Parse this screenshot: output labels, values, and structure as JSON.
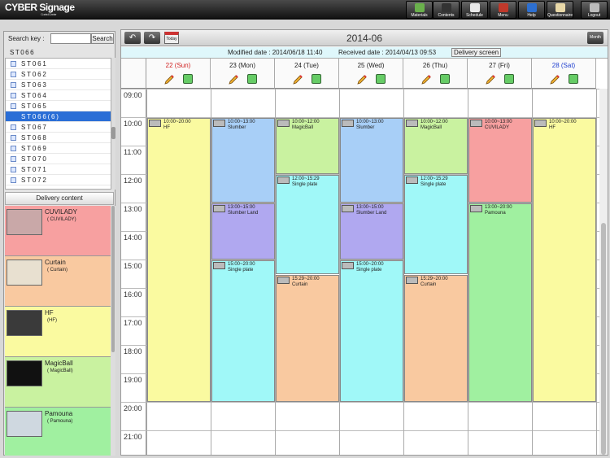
{
  "app": {
    "logo": "CYBER Signage",
    "logo_sub": "Control Center"
  },
  "nav": [
    {
      "label": "Materials",
      "name": "materials-button",
      "icon": "materials-icon",
      "color": "#6ab04c"
    },
    {
      "label": "Contents",
      "name": "contents-button",
      "icon": "contents-icon",
      "color": "#333333"
    },
    {
      "label": "Schedule",
      "name": "schedule-button",
      "icon": "schedule-icon",
      "color": "#e8e8e8"
    },
    {
      "label": "Menu",
      "name": "menu-button",
      "icon": "home-icon",
      "color": "#c0392b"
    },
    {
      "label": "Help",
      "name": "help-button",
      "icon": "help-icon",
      "color": "#2d6fd0"
    },
    {
      "label": "Questionnaire",
      "name": "questionnaire-button",
      "icon": "questionnaire-icon",
      "color": "#e8d8a8"
    },
    {
      "label": "Logout",
      "name": "logout-button",
      "icon": "logout-icon",
      "color": "#bbbbbb"
    }
  ],
  "search": {
    "label": "Search key :",
    "button": "Search",
    "value": ""
  },
  "current_station": "ST066",
  "stations": [
    "ST061",
    "ST062",
    "ST063",
    "ST064",
    "ST065",
    "ST066(6)",
    "ST067",
    "ST068",
    "ST069",
    "ST070",
    "ST071",
    "ST072"
  ],
  "selected_station": "ST066(6)",
  "delivery_content": {
    "header": "Delivery content",
    "items": [
      {
        "name": "CUVILADY",
        "sub": "( CUVILADY)",
        "color": "#f7a0a0"
      },
      {
        "name": "Curtain",
        "sub": "( Curtain)",
        "color": "#f9c9a0"
      },
      {
        "name": "HF",
        "sub": "(HF)",
        "color": "#fafaa0"
      },
      {
        "name": "MagicBall",
        "sub": "( MagicBall)",
        "color": "#c9f2a0"
      },
      {
        "name": "Pamouna",
        "sub": "( Pamouna)",
        "color": "#a0f0a0"
      }
    ]
  },
  "calendar": {
    "month": "2014-06",
    "today_label": "Today",
    "month_button": "Month",
    "modified": "Modified date : 2014/06/18 11:40",
    "received": "Received date : 2014/04/13 09:53",
    "delivery_screen": "Delivery screen",
    "days": [
      {
        "label": "22 (Sun)",
        "color": "#d02020"
      },
      {
        "label": "23 (Mon)",
        "color": "#222222"
      },
      {
        "label": "24 (Tue)",
        "color": "#222222"
      },
      {
        "label": "25 (Wed)",
        "color": "#222222"
      },
      {
        "label": "26 (Thu)",
        "color": "#222222"
      },
      {
        "label": "27 (Fri)",
        "color": "#222222"
      },
      {
        "label": "28 (Sat)",
        "color": "#2040d0"
      }
    ],
    "hours": [
      "09:00",
      "10:00",
      "11:00",
      "12:00",
      "13:00",
      "14:00",
      "15:00",
      "16:00",
      "17:00",
      "18:00",
      "19:00",
      "20:00",
      "21:00"
    ],
    "events": [
      {
        "day": 0,
        "start": 10,
        "end": 20,
        "time": "10:00~20:00",
        "name": "HF",
        "color": "#fafaa0"
      },
      {
        "day": 1,
        "start": 10,
        "end": 13,
        "time": "10:00~13:00",
        "name": "Slumber",
        "color": "#a8cff7"
      },
      {
        "day": 1,
        "start": 13,
        "end": 15,
        "time": "13:00~15:00",
        "name": "Slumber Land",
        "color": "#b0a8f0"
      },
      {
        "day": 1,
        "start": 15,
        "end": 20,
        "time": "15:00~20:00",
        "name": "Single plate",
        "color": "#a0f8f8"
      },
      {
        "day": 2,
        "start": 10,
        "end": 12,
        "time": "10:00~12:00",
        "name": "MagicBall",
        "color": "#c9f2a0"
      },
      {
        "day": 2,
        "start": 12,
        "end": 15.5,
        "time": "12:00~15:29",
        "name": "Single plate",
        "color": "#a0f8f8"
      },
      {
        "day": 2,
        "start": 15.5,
        "end": 20,
        "time": "15:29~20:00",
        "name": "Curtain",
        "color": "#f9c9a0"
      },
      {
        "day": 3,
        "start": 10,
        "end": 13,
        "time": "10:00~13:00",
        "name": "Slumber",
        "color": "#a8cff7"
      },
      {
        "day": 3,
        "start": 13,
        "end": 15,
        "time": "13:00~15:00",
        "name": "Slumber Land",
        "color": "#b0a8f0"
      },
      {
        "day": 3,
        "start": 15,
        "end": 20,
        "time": "15:00~20:00",
        "name": "Single plate",
        "color": "#a0f8f8"
      },
      {
        "day": 4,
        "start": 10,
        "end": 12,
        "time": "10:00~12:00",
        "name": "MagicBall",
        "color": "#c9f2a0"
      },
      {
        "day": 4,
        "start": 12,
        "end": 15.5,
        "time": "12:00~15:29",
        "name": "Single plate",
        "color": "#a0f8f8"
      },
      {
        "day": 4,
        "start": 15.5,
        "end": 20,
        "time": "15:29~20:00",
        "name": "Curtain",
        "color": "#f9c9a0"
      },
      {
        "day": 5,
        "start": 10,
        "end": 13,
        "time": "10:00~13:00",
        "name": "CUVILADY",
        "color": "#f7a0a0"
      },
      {
        "day": 5,
        "start": 13,
        "end": 20,
        "time": "13:00~20:00",
        "name": "Pamouna",
        "color": "#a0f0a0"
      },
      {
        "day": 6,
        "start": 10,
        "end": 20,
        "time": "10:00~20:00",
        "name": "HF",
        "color": "#fafaa0"
      }
    ]
  }
}
